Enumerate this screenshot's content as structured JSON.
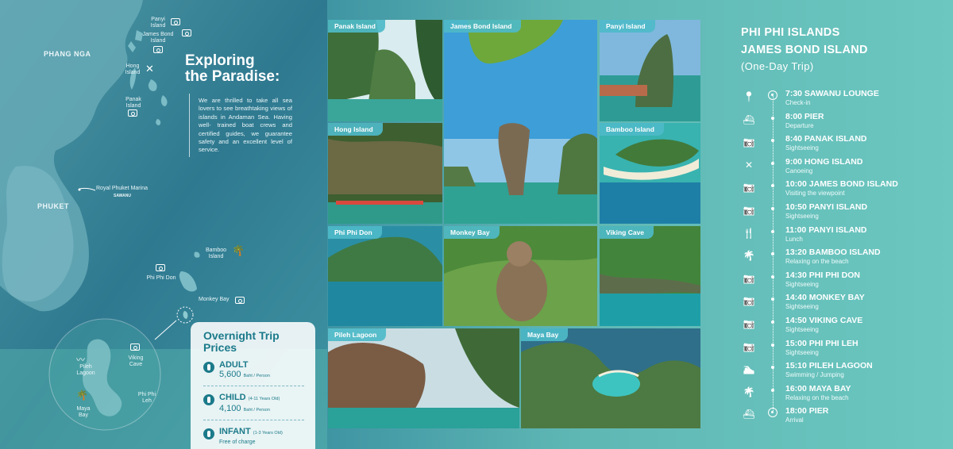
{
  "map": {
    "regions": {
      "phang_nga": "PHANG NGA",
      "phuket": "PHUKET"
    },
    "islands": {
      "panyi": "Panyi Island",
      "james_bond": "James Bond Island",
      "hong": "Hong Island",
      "panak": "Panak Island",
      "bamboo": "Bamboo Island",
      "phi_phi_don": "Phi Phi Don",
      "monkey_bay": "Monkey Bay",
      "pileh_lagoon": "Pileh Lagoon",
      "viking_cave": "Viking Cave",
      "phi_phi_leh": "Phi Phi Leh",
      "maya_bay": "Maya Bay"
    },
    "marina": {
      "label": "Royal Phuket Marina",
      "brand": "SAWANU"
    }
  },
  "intro": {
    "title_line1": "Exploring",
    "title_line2": "the Paradise:",
    "body": "We are thrilled to take all sea lovers to see breathtaking views of islands in Andaman Sea. Having well- trained boat crews and certified guides, we guarantee safety and an excellent level of service."
  },
  "prices": {
    "title_line1": "Overnight Trip",
    "title_line2": "Prices",
    "rows": [
      {
        "name": "ADULT",
        "note": "",
        "value": "5,600",
        "unit": "Baht / Person"
      },
      {
        "name": "CHILD",
        "note": "(4-11 Years Old)",
        "value": "4,100",
        "unit": "Baht / Person"
      },
      {
        "name": "INFANT",
        "note": "(1-3 Years Old)",
        "value": "Free of charge",
        "unit": ""
      }
    ]
  },
  "photos": {
    "panak": "Panak Island",
    "james_bond": "James Bond Island",
    "panyi": "Panyi Island",
    "hong": "Hong Island",
    "bamboo": "Bamboo Island",
    "phi_phi_don": "Phi Phi Don",
    "monkey_bay": "Monkey Bay",
    "viking_cave": "Viking Cave",
    "pileh": "Pileh Lagoon",
    "maya": "Maya Bay"
  },
  "trip": {
    "title_line1": "PHI PHI ISLANDS",
    "title_line2": "JAMES BOND ISLAND",
    "subtitle": "(One-Day Trip)",
    "stops": [
      {
        "time": "7:30 SAWANU LOUNGE",
        "activity": "Check-in",
        "icon": "location-pin-icon"
      },
      {
        "time": "8:00 PIER",
        "activity": "Departure",
        "icon": "boat-icon"
      },
      {
        "time": "8:40 PANAK ISLAND",
        "activity": "Sightseeing",
        "icon": "camera-icon"
      },
      {
        "time": "9:00 HONG ISLAND",
        "activity": "Canoeing",
        "icon": "paddles-icon"
      },
      {
        "time": "10:00 JAMES BOND ISLAND",
        "activity": "Visiting the viewpoint",
        "icon": "camera-icon"
      },
      {
        "time": "10:50 PANYI ISLAND",
        "activity": "Sightseeing",
        "icon": "camera-icon"
      },
      {
        "time": "11:00 PANYI ISLAND",
        "activity": "Lunch",
        "icon": "cutlery-icon"
      },
      {
        "time": "13:20 BAMBOO ISLAND",
        "activity": "Relaxing on the beach",
        "icon": "palm-tree-icon"
      },
      {
        "time": "14:30 PHI PHI DON",
        "activity": "Sightseeing",
        "icon": "camera-icon"
      },
      {
        "time": "14:40 MONKEY BAY",
        "activity": "Sightseeing",
        "icon": "camera-icon"
      },
      {
        "time": "14:50 VIKING CAVE",
        "activity": "Sightseeing",
        "icon": "camera-icon"
      },
      {
        "time": "15:00 PHI PHI LEH",
        "activity": "Sightseeing",
        "icon": "camera-icon"
      },
      {
        "time": "15:10 PILEH LAGOON",
        "activity": "Swimming / Jumping",
        "icon": "swimmer-icon"
      },
      {
        "time": "16:00 MAYA BAY",
        "activity": "Relaxing on the beach",
        "icon": "palm-tree-icon"
      },
      {
        "time": "18:00 PIER",
        "activity": "Arrival",
        "icon": "boat-icon"
      }
    ]
  }
}
